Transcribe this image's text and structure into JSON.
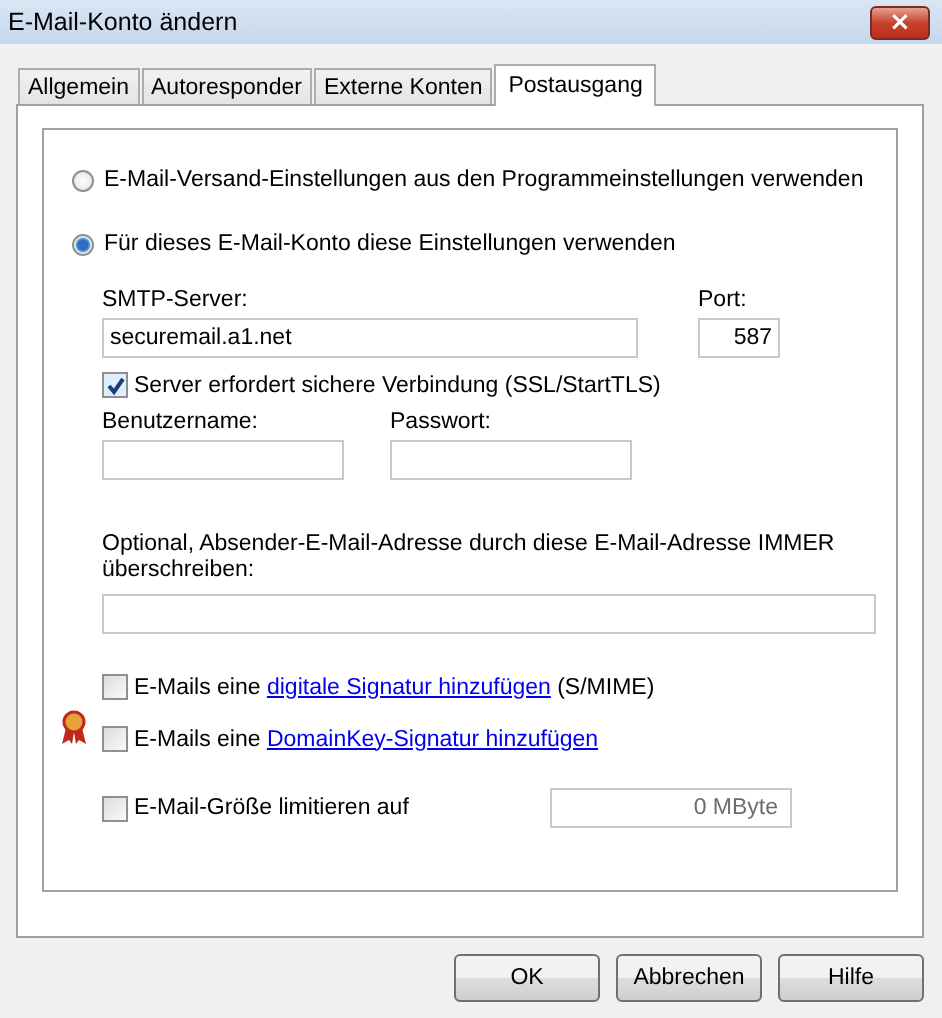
{
  "window": {
    "title": "E-Mail-Konto ändern",
    "close": "×"
  },
  "tabs": [
    {
      "label": "Allgemein",
      "selected": false
    },
    {
      "label": "Autoresponder",
      "selected": false
    },
    {
      "label": "Externe Konten",
      "selected": false
    },
    {
      "label": "Postausgang",
      "selected": true
    }
  ],
  "send_mode": [
    {
      "label": "E-Mail-Versand-Einstellungen aus den Programmeinstellungen verwenden",
      "selected": false
    },
    {
      "label": "Für dieses E-Mail-Konto diese Einstellungen verwenden",
      "selected": true
    }
  ],
  "smtp_server": {
    "label": "SMTP-Server:",
    "value": "securemail.a1.net"
  },
  "port": {
    "label": "Port:",
    "value": "587"
  },
  "secure_connection": {
    "label": "Server erfordert sichere Verbindung (SSL/StartTLS)",
    "checked": true
  },
  "username": {
    "label": "Benutzername:"
  },
  "password": {
    "label": "Passwort:"
  },
  "override_sender": {
    "label": "Optional, Absender-E-Mail-Adresse durch diese E-Mail-Adresse IMMER überschreiben:"
  },
  "signatures": [
    {
      "before": "E-Mails eine ",
      "link": "digitale Signatur hinzufügen",
      "after": " (S/MIME)",
      "checked": false
    },
    {
      "before": "E-Mails eine ",
      "link": "DomainKey-Signatur hinzufügen",
      "checked": false
    }
  ],
  "size_limit": {
    "label": "E-Mail-Größe limitieren auf",
    "checked": false,
    "value": "0 MByte",
    "disabled": true
  },
  "buttons": [
    "OK",
    "Abbrechen",
    "Hilfe"
  ]
}
